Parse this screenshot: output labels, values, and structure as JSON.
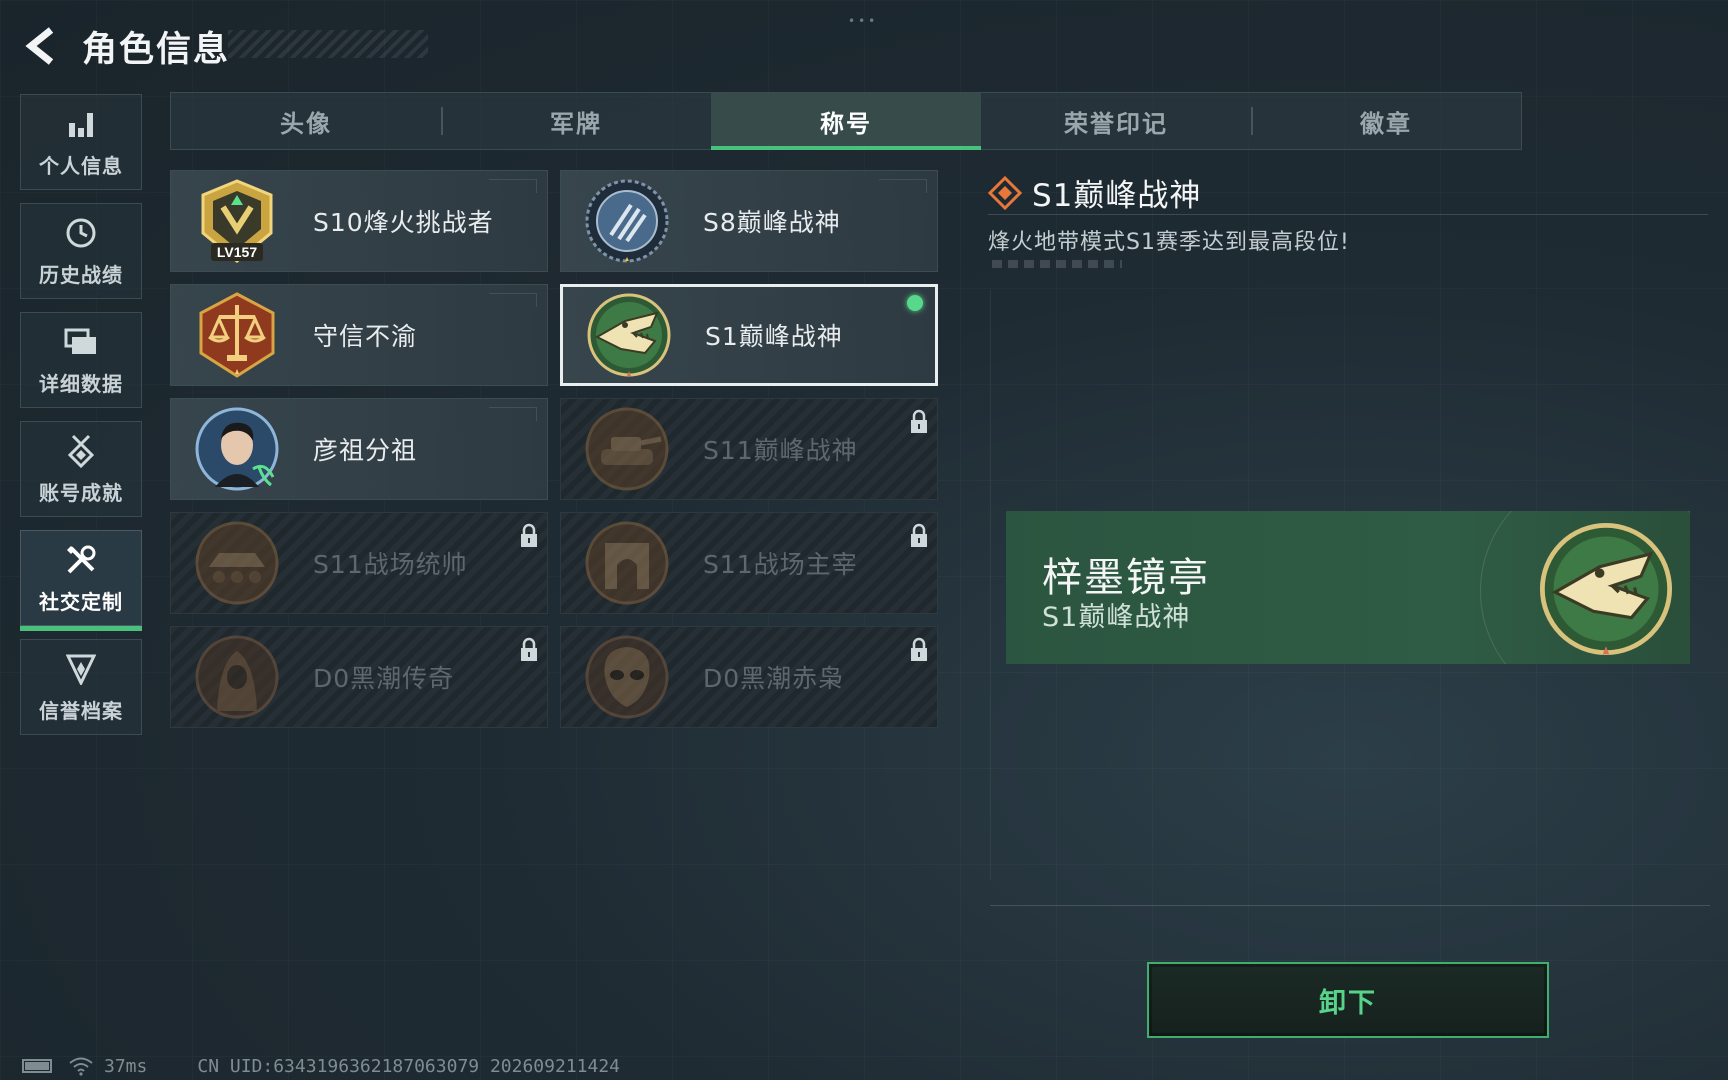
{
  "header": {
    "title": "角色信息"
  },
  "sidebar": {
    "items": [
      {
        "label": "个人信息",
        "icon": "bar-chart-icon",
        "active": false
      },
      {
        "label": "历史战绩",
        "icon": "clock-icon",
        "active": false
      },
      {
        "label": "详细数据",
        "icon": "folders-icon",
        "active": false
      },
      {
        "label": "账号成就",
        "icon": "medal-icon",
        "active": false
      },
      {
        "label": "社交定制",
        "icon": "tools-icon",
        "active": true
      },
      {
        "label": "信誉档案",
        "icon": "shield-icon",
        "active": false
      }
    ]
  },
  "tabs": [
    {
      "label": "头像",
      "active": false
    },
    {
      "label": "军牌",
      "active": false
    },
    {
      "label": "称号",
      "active": true
    },
    {
      "label": "荣誉印记",
      "active": false
    },
    {
      "label": "徽章",
      "active": false
    }
  ],
  "titles": [
    {
      "label": "S10烽火挑战者",
      "badge": "lv157-badge-icon",
      "badge_text": "LV157",
      "locked": false,
      "selected": false,
      "equipped": false
    },
    {
      "label": "S8巅峰战神",
      "badge": "striped-shield-badge-icon",
      "locked": false,
      "selected": false,
      "equipped": false
    },
    {
      "label": "守信不渝",
      "badge": "scales-badge-icon",
      "locked": false,
      "selected": false,
      "equipped": false
    },
    {
      "label": "S1巅峰战神",
      "badge": "crocodile-badge-icon",
      "locked": false,
      "selected": true,
      "equipped": true
    },
    {
      "label": "彦祖分祖",
      "badge": "portrait-badge-icon",
      "locked": false,
      "selected": false,
      "equipped": false
    },
    {
      "label": "S11巅峰战神",
      "badge": "tank-badge-icon",
      "locked": true,
      "selected": false,
      "equipped": false
    },
    {
      "label": "S11战场统帅",
      "badge": "armored-vehicle-badge-icon",
      "locked": true,
      "selected": false,
      "equipped": false
    },
    {
      "label": "S11战场主宰",
      "badge": "arch-badge-icon",
      "locked": true,
      "selected": false,
      "equipped": false
    },
    {
      "label": "D0黑潮传奇",
      "badge": "hooded-figure-badge-icon",
      "locked": true,
      "selected": false,
      "equipped": false
    },
    {
      "label": "D0黑潮赤枭",
      "badge": "alien-head-badge-icon",
      "locked": true,
      "selected": false,
      "equipped": false
    }
  ],
  "detail": {
    "name": "S1巅峰战神",
    "description": "烽火地带模式S1赛季达到最高段位!"
  },
  "preview": {
    "player_name": "梓墨镜亭",
    "title": "S1巅峰战神"
  },
  "actions": {
    "unequip_label": "卸下"
  },
  "footer": {
    "ping": "37ms",
    "uid": "CN UID:6343196362187063079 202609211424"
  },
  "colors": {
    "accent_green": "#49c07c",
    "equipped_dot": "#58d88a",
    "preview_bg": "#2f5c44",
    "detail_icon": "#e8773a"
  }
}
